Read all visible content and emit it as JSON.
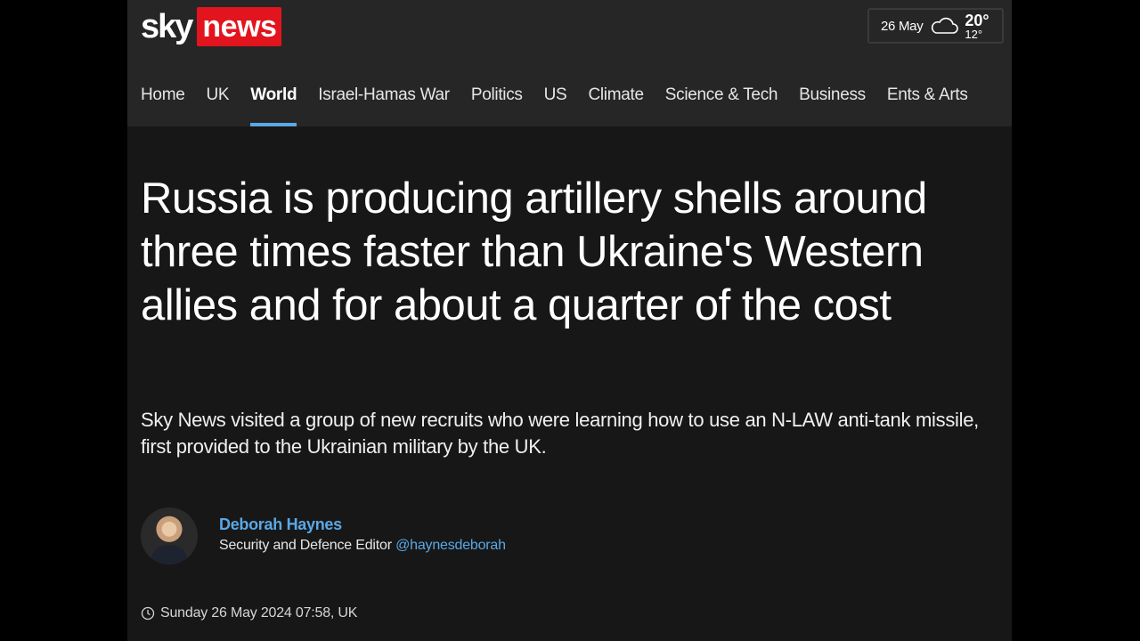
{
  "brand": {
    "sky": "sky",
    "news": "news",
    "accent": "#e2141d"
  },
  "weather": {
    "date": "26 May",
    "icon": "cloud-icon",
    "high": "20°",
    "low": "12°"
  },
  "nav": {
    "items": [
      {
        "label": "Home"
      },
      {
        "label": "UK"
      },
      {
        "label": "World"
      },
      {
        "label": "Israel-Hamas War"
      },
      {
        "label": "Politics"
      },
      {
        "label": "US"
      },
      {
        "label": "Climate"
      },
      {
        "label": "Science & Tech"
      },
      {
        "label": "Business"
      },
      {
        "label": "Ents & Arts"
      }
    ],
    "active": "World",
    "active_color": "#5aa8e6"
  },
  "article": {
    "headline": "Russia is producing artillery shells around three times faster than Ukraine's Western allies and for about a quarter of the cost",
    "standfirst": "Sky News visited a group of new recruits who were learning how to use an N-LAW anti-tank missile, first provided to the Ukrainian military by the UK.",
    "author": {
      "name": "Deborah Haynes",
      "role": "Security and Defence Editor",
      "handle": "@haynesdeborah"
    },
    "dateline": "Sunday 26 May 2024 07:58, UK",
    "dateline_icon": "clock-icon"
  }
}
